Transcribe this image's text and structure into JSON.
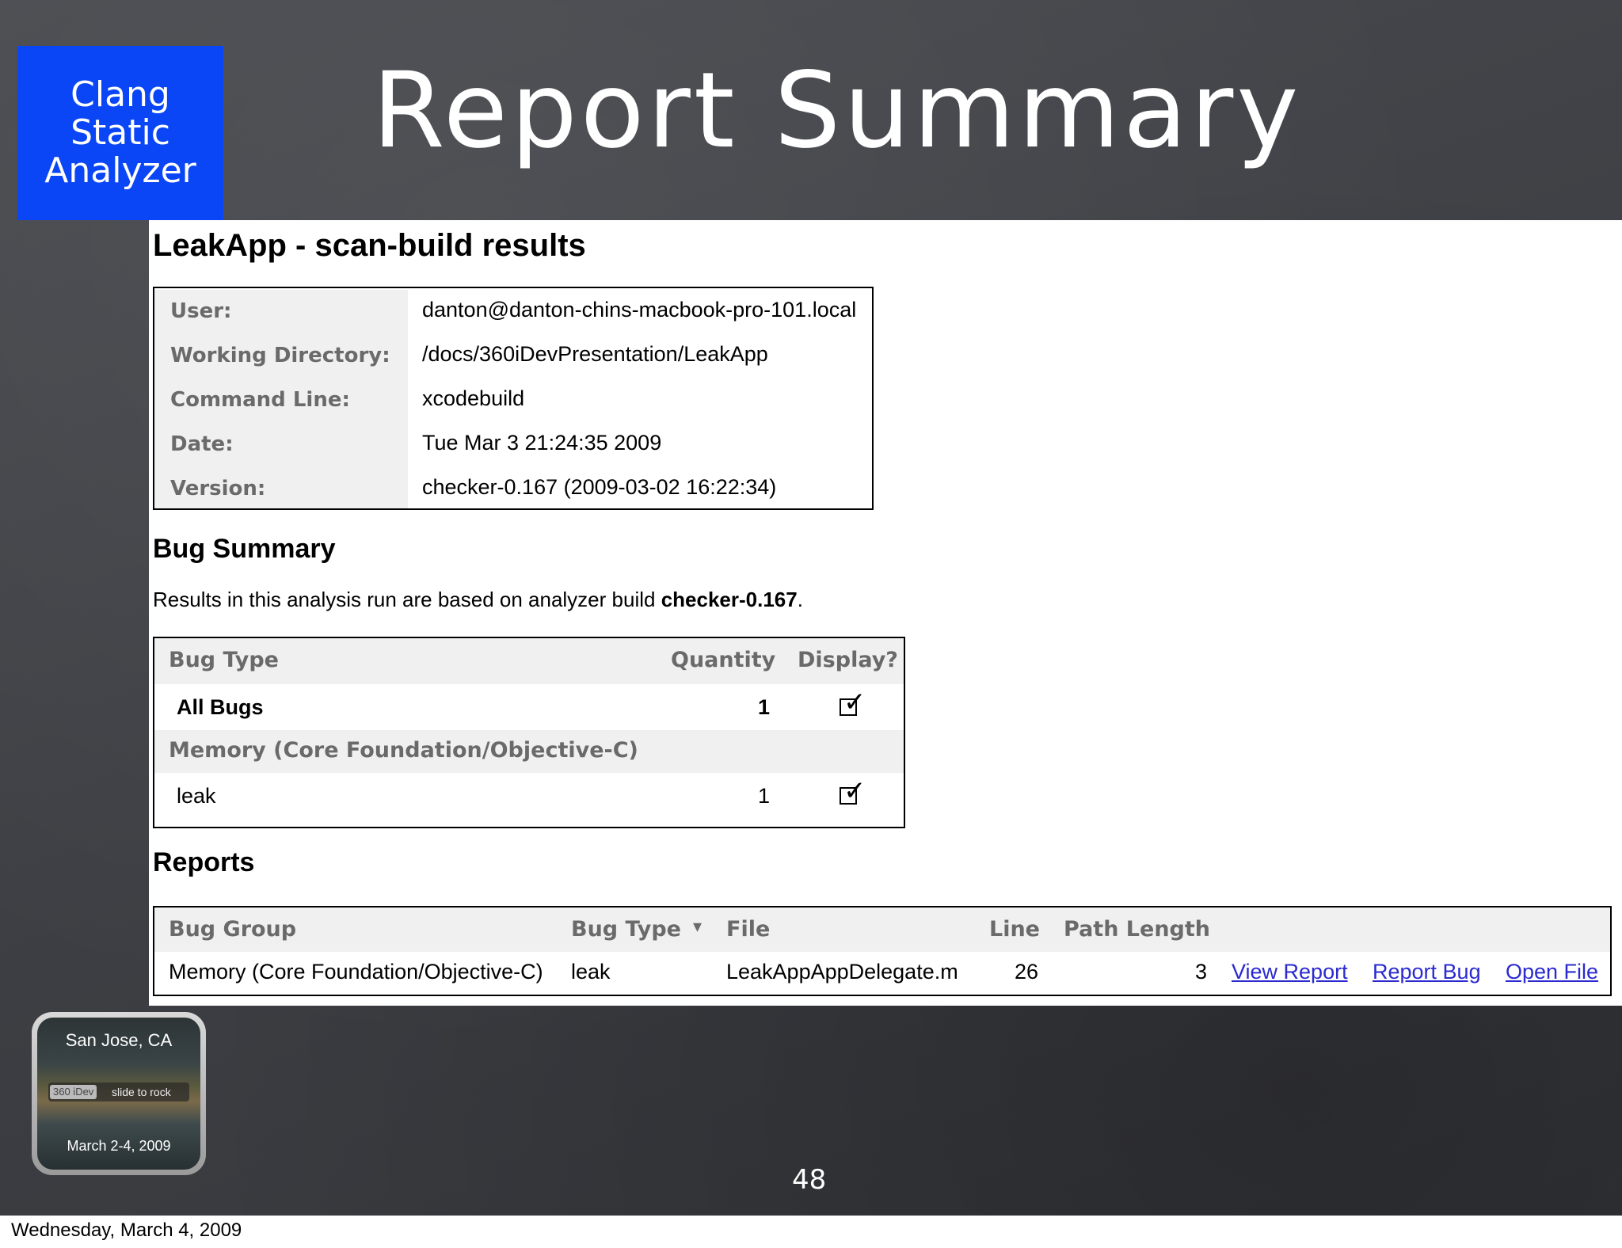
{
  "slide": {
    "badge_lines": [
      "Clang",
      "Static",
      "Analyzer"
    ],
    "title": "Report Summary",
    "page_number": "48",
    "footer_date": "Wednesday, March 4, 2009",
    "conference": {
      "city": "San Jose, CA",
      "logo": "360 iDev",
      "slide_text": "slide to rock",
      "dates": "March 2-4, 2009"
    }
  },
  "report": {
    "heading": "LeakApp - scan-build results",
    "info": [
      {
        "key": "User:",
        "value": "danton@danton-chins-macbook-pro-101.local"
      },
      {
        "key": "Working Directory:",
        "value": "/docs/360iDevPresentation/LeakApp"
      },
      {
        "key": "Command Line:",
        "value": "xcodebuild"
      },
      {
        "key": "Date:",
        "value": "Tue Mar 3 21:24:35 2009"
      },
      {
        "key": "Version:",
        "value": "checker-0.167 (2009-03-02 16:22:34)"
      }
    ],
    "bug_summary": {
      "heading": "Bug Summary",
      "text_prefix": "Results in this analysis run are based on analyzer build ",
      "text_bold": "checker-0.167",
      "text_suffix": ".",
      "columns": {
        "bug_type": "Bug Type",
        "quantity": "Quantity",
        "display": "Display?"
      },
      "all_bugs": {
        "label": "All Bugs",
        "quantity": "1",
        "checked": true
      },
      "group": "Memory (Core Foundation/Objective-C)",
      "leak": {
        "label": "leak",
        "quantity": "1",
        "checked": true
      }
    },
    "reports": {
      "heading": "Reports",
      "columns": {
        "bug_group": "Bug Group",
        "bug_type": "Bug Type",
        "sort_indicator": "▾",
        "file": "File",
        "line": "Line",
        "path_length": "Path Length"
      },
      "row": {
        "bug_group": "Memory (Core Foundation/Objective-C)",
        "bug_type": "leak",
        "file": "LeakAppAppDelegate.m",
        "line": "26",
        "path_length": "3",
        "view_report": "View Report",
        "report_bug": "Report Bug",
        "open_file": "Open File"
      }
    }
  },
  "colors": {
    "slide_background": "#3c3e43",
    "badge_blue": "#0a46f5",
    "header_gray": "#6a6a6a",
    "row_shade": "#f0f0f0",
    "link": "#2a2ad0"
  }
}
